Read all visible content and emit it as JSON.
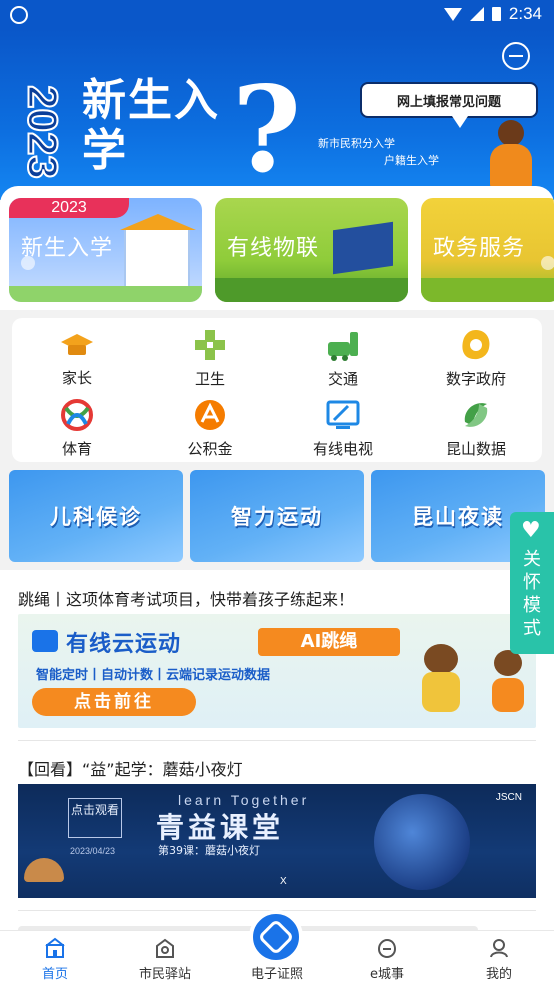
{
  "status_bar": {
    "time": "2:34"
  },
  "banner": {
    "year": "2023",
    "title": "新生入学",
    "question_mark": "?",
    "bubble": "网上填报常见问题",
    "caption_1": "新市民积分入学",
    "caption_2": "户籍生入学"
  },
  "service_cards": [
    {
      "label": "新生入学",
      "ribbon": "2023"
    },
    {
      "label": "有线物联"
    },
    {
      "label": "政务服务"
    }
  ],
  "quick_grid": [
    {
      "label": "家长",
      "icon": "graduation-cap-icon"
    },
    {
      "label": "卫生",
      "icon": "health-cross-icon"
    },
    {
      "label": "交通",
      "icon": "transit-icon"
    },
    {
      "label": "数字政府",
      "icon": "digital-gov-icon"
    },
    {
      "label": "体育",
      "icon": "sports-icon"
    },
    {
      "label": "公积金",
      "icon": "housing-fund-icon"
    },
    {
      "label": "有线电视",
      "icon": "tv-icon"
    },
    {
      "label": "昆山数据",
      "icon": "data-icon"
    }
  ],
  "feature_tiles": [
    "儿科候诊",
    "智力运动",
    "昆山夜读"
  ],
  "care_mode": {
    "label": "关怀模式"
  },
  "feed": [
    {
      "title": "跳绳丨这项体育考试项目，快带着孩子练起来！",
      "promo": {
        "headline": "有线云运动",
        "tag": "AI跳绳",
        "subtitle": "智能定时丨自动计数丨云端记录运动数据",
        "cta": "点击前往"
      }
    },
    {
      "title": "【回看】“益”起学：蘑菇小夜灯",
      "promo": {
        "box_text": "点击观看",
        "date": "2023/04/23",
        "en_title": "learn Together",
        "big_title": "青益课堂",
        "episode": "第39课：蘑菇小夜灯",
        "brand": "JSCN",
        "x_mark": "X"
      }
    }
  ],
  "tabbar": {
    "tabs": [
      {
        "label": "首页",
        "icon": "home-icon",
        "active": true
      },
      {
        "label": "市民驿站",
        "icon": "citizen-station-icon",
        "active": false
      },
      {
        "label": "电子证照",
        "icon": "e-license-icon",
        "active": false
      },
      {
        "label": "e城事",
        "icon": "city-affairs-icon",
        "active": false
      },
      {
        "label": "我的",
        "icon": "profile-icon",
        "active": false
      }
    ]
  },
  "colors": {
    "primary": "#1a73e8",
    "banner_blue": "#0a57c9",
    "care_mode": "#29c3a9",
    "orange": "#f58a1f"
  }
}
